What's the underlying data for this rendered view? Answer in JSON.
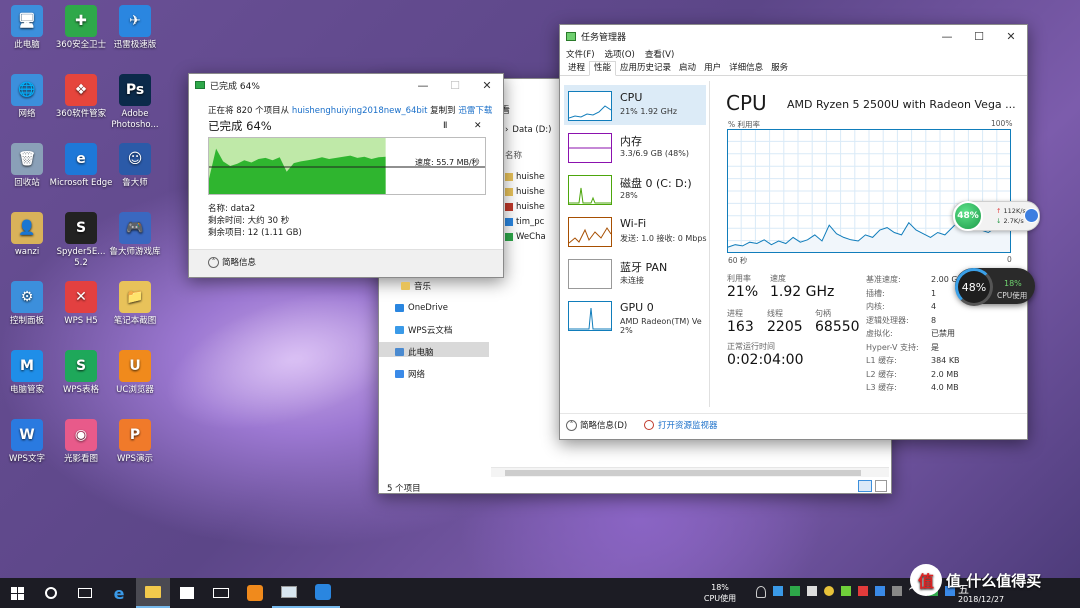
{
  "desktop_icons": [
    {
      "label": "此电脑",
      "color": "#3c8fdc",
      "glyph": "🖥"
    },
    {
      "label": "360安全卫士",
      "color": "#2ea84a",
      "glyph": "✚"
    },
    {
      "label": "迅雷极速版",
      "color": "#2a86e0",
      "glyph": "✈"
    },
    {
      "label": "网络",
      "color": "#3c8fdc",
      "glyph": "🌐"
    },
    {
      "label": "360软件管家",
      "color": "#e6453c",
      "glyph": "❖"
    },
    {
      "label": "Adobe Photosho...",
      "color": "#0b2a4a",
      "glyph": "Ps"
    },
    {
      "label": "回收站",
      "color": "#8aa0b8",
      "glyph": "🗑"
    },
    {
      "label": "Microsoft Edge",
      "color": "#1e78d8",
      "glyph": "e"
    },
    {
      "label": "鲁大师",
      "color": "#2b5aa8",
      "glyph": "☺"
    },
    {
      "label": "wanzi",
      "color": "#d9b25a",
      "glyph": "👤"
    },
    {
      "label": "Spyder5E... 5.2",
      "color": "#222",
      "glyph": "S"
    },
    {
      "label": "鲁大师游戏库",
      "color": "#3a68c0",
      "glyph": "🎮"
    },
    {
      "label": "控制面板",
      "color": "#3c8fdc",
      "glyph": "⚙"
    },
    {
      "label": "WPS H5",
      "color": "#e34040",
      "glyph": "✕"
    },
    {
      "label": "笔记本截图",
      "color": "#e8c25a",
      "glyph": "📁"
    },
    {
      "label": "电脑管家",
      "color": "#1f8ee8",
      "glyph": "M"
    },
    {
      "label": "WPS表格",
      "color": "#1ea85a",
      "glyph": "S"
    },
    {
      "label": "UC浏览器",
      "color": "#f08a1c",
      "glyph": "U"
    },
    {
      "label": "WPS文字",
      "color": "#2a7ae0",
      "glyph": "W"
    },
    {
      "label": "光影看图",
      "color": "#e85a8a",
      "glyph": "◉"
    },
    {
      "label": "WPS演示",
      "color": "#f07a2a",
      "glyph": "P"
    }
  ],
  "copy_dialog": {
    "title": "已完成 64%",
    "line_prefix": "正在将 820 个项目从 ",
    "source": "huishenghuiying2018new_64bit",
    "line_mid": " 复制到 ",
    "dest": "迅雷下载",
    "progress_label": "已完成 64%",
    "progress": 0.64,
    "speed": "速度: 55.7 MB/秒",
    "name": "名称: data2",
    "time_left": "剩余时间: 大约 30 秒",
    "items_left": "剩余项目: 12 (1.11 GB)",
    "less_details": "简略信息",
    "pause": "Ⅱ",
    "close": "✕"
  },
  "explorer": {
    "address": "Data (D:)",
    "column_name": "名称",
    "files": [
      "huishenghu",
      "huishenghu",
      "huishenghu",
      "tim_pc",
      "WeChatSe"
    ],
    "nav": [
      "音乐",
      "OneDrive",
      "WPS云文档",
      "此电脑",
      "网络"
    ],
    "status": "5 个项目",
    "up": "上",
    "down": "下"
  },
  "task_manager": {
    "title": "任务管理器",
    "menu": [
      "文件(F)",
      "选项(O)",
      "查看(V)"
    ],
    "tabs": [
      "进程",
      "性能",
      "应用历史记录",
      "启动",
      "用户",
      "详细信息",
      "服务"
    ],
    "side": [
      {
        "name": "CPU",
        "sub": "21% 1.92 GHz",
        "color": "#117dbb"
      },
      {
        "name": "内存",
        "sub": "3.3/6.9 GB (48%)",
        "color": "#8b12ae"
      },
      {
        "name": "磁盘 0 (C: D:)",
        "sub": "28%",
        "color": "#4da60c"
      },
      {
        "name": "Wi-Fi",
        "sub": "发送: 1.0 接收: 0 Mbps",
        "color": "#a74f01"
      },
      {
        "name": "蓝牙 PAN",
        "sub": "未连接",
        "color": "#999999"
      },
      {
        "name": "GPU 0",
        "sub": "AMD Radeon(TM) Ve",
        "sub2": "2%",
        "color": "#117dbb"
      }
    ],
    "cpu_title": "CPU",
    "cpu_model": "AMD Ryzen 5 2500U with Radeon Vega ...",
    "util_label": "% 利用率",
    "util_max": "100%",
    "time_left": "60 秒",
    "time_right": "0",
    "stats": {
      "util_lab": "利用率",
      "util_val": "21%",
      "speed_lab": "速度",
      "speed_val": "1.92 GHz",
      "proc_lab": "进程",
      "proc_val": "163",
      "thread_lab": "线程",
      "thread_val": "2205",
      "handle_lab": "句柄",
      "handle_val": "68550",
      "uptime_lab": "正常运行时间",
      "uptime_val": "0:02:04:00"
    },
    "specs": [
      [
        "基准速度:",
        "2.00 G"
      ],
      [
        "插槽:",
        "1"
      ],
      [
        "内核:",
        "4"
      ],
      [
        "逻辑处理器:",
        "8"
      ],
      [
        "虚拟化:",
        "已禁用"
      ],
      [
        "Hyper-V 支持:",
        "是"
      ],
      [
        "L1 缓存:",
        "384 KB"
      ],
      [
        "L2 缓存:",
        "2.0 MB"
      ],
      [
        "L3 缓存:",
        "4.0 MB"
      ]
    ],
    "less_details": "简略信息(D)",
    "open_monitor": "打开资源监视器",
    "cpu_history": [
      4,
      6,
      5,
      8,
      7,
      10,
      6,
      9,
      7,
      12,
      8,
      10,
      14,
      9,
      22,
      15,
      12,
      10,
      9,
      14,
      12,
      18,
      20,
      16,
      14,
      24,
      18,
      15,
      12,
      16,
      14,
      20,
      26,
      38,
      22,
      18,
      16,
      20,
      24,
      21
    ]
  },
  "widgets": {
    "ball_pct": "48%",
    "net_up": "112K/s",
    "net_down": "2.7K/s",
    "ring_pct": "48%",
    "cpu_pct": "18%",
    "cpu_label": "CPU使用"
  },
  "taskbar": {
    "cpu_pct": "18%",
    "cpu_label": "CPU使用",
    "ime": "五",
    "date": "2018/12/27",
    "watermark": "值 什么值得买"
  }
}
